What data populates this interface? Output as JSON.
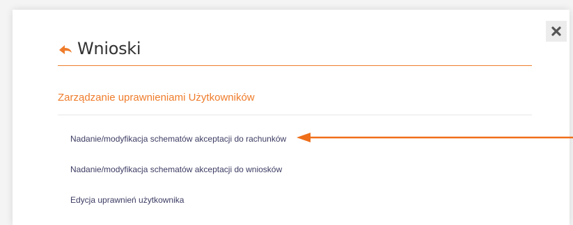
{
  "header": {
    "title": "Wnioski",
    "back_icon": "back-arrow-icon",
    "close_icon": "close-icon"
  },
  "section": {
    "heading": "Zarządzanie uprawnieniami Użytkowników",
    "links": [
      "Nadanie/modyfikacja schematów akceptacji do rachunków",
      "Nadanie/modyfikacja schematów akceptacji do wniosków",
      "Edycja uprawnień użytkownika"
    ]
  },
  "annotation": {
    "arrow_icon": "pointer-arrow-icon",
    "color": "#ef6f1a"
  },
  "colors": {
    "accent": "#ef7c2b",
    "link": "#3b3b63",
    "title": "#333333"
  }
}
